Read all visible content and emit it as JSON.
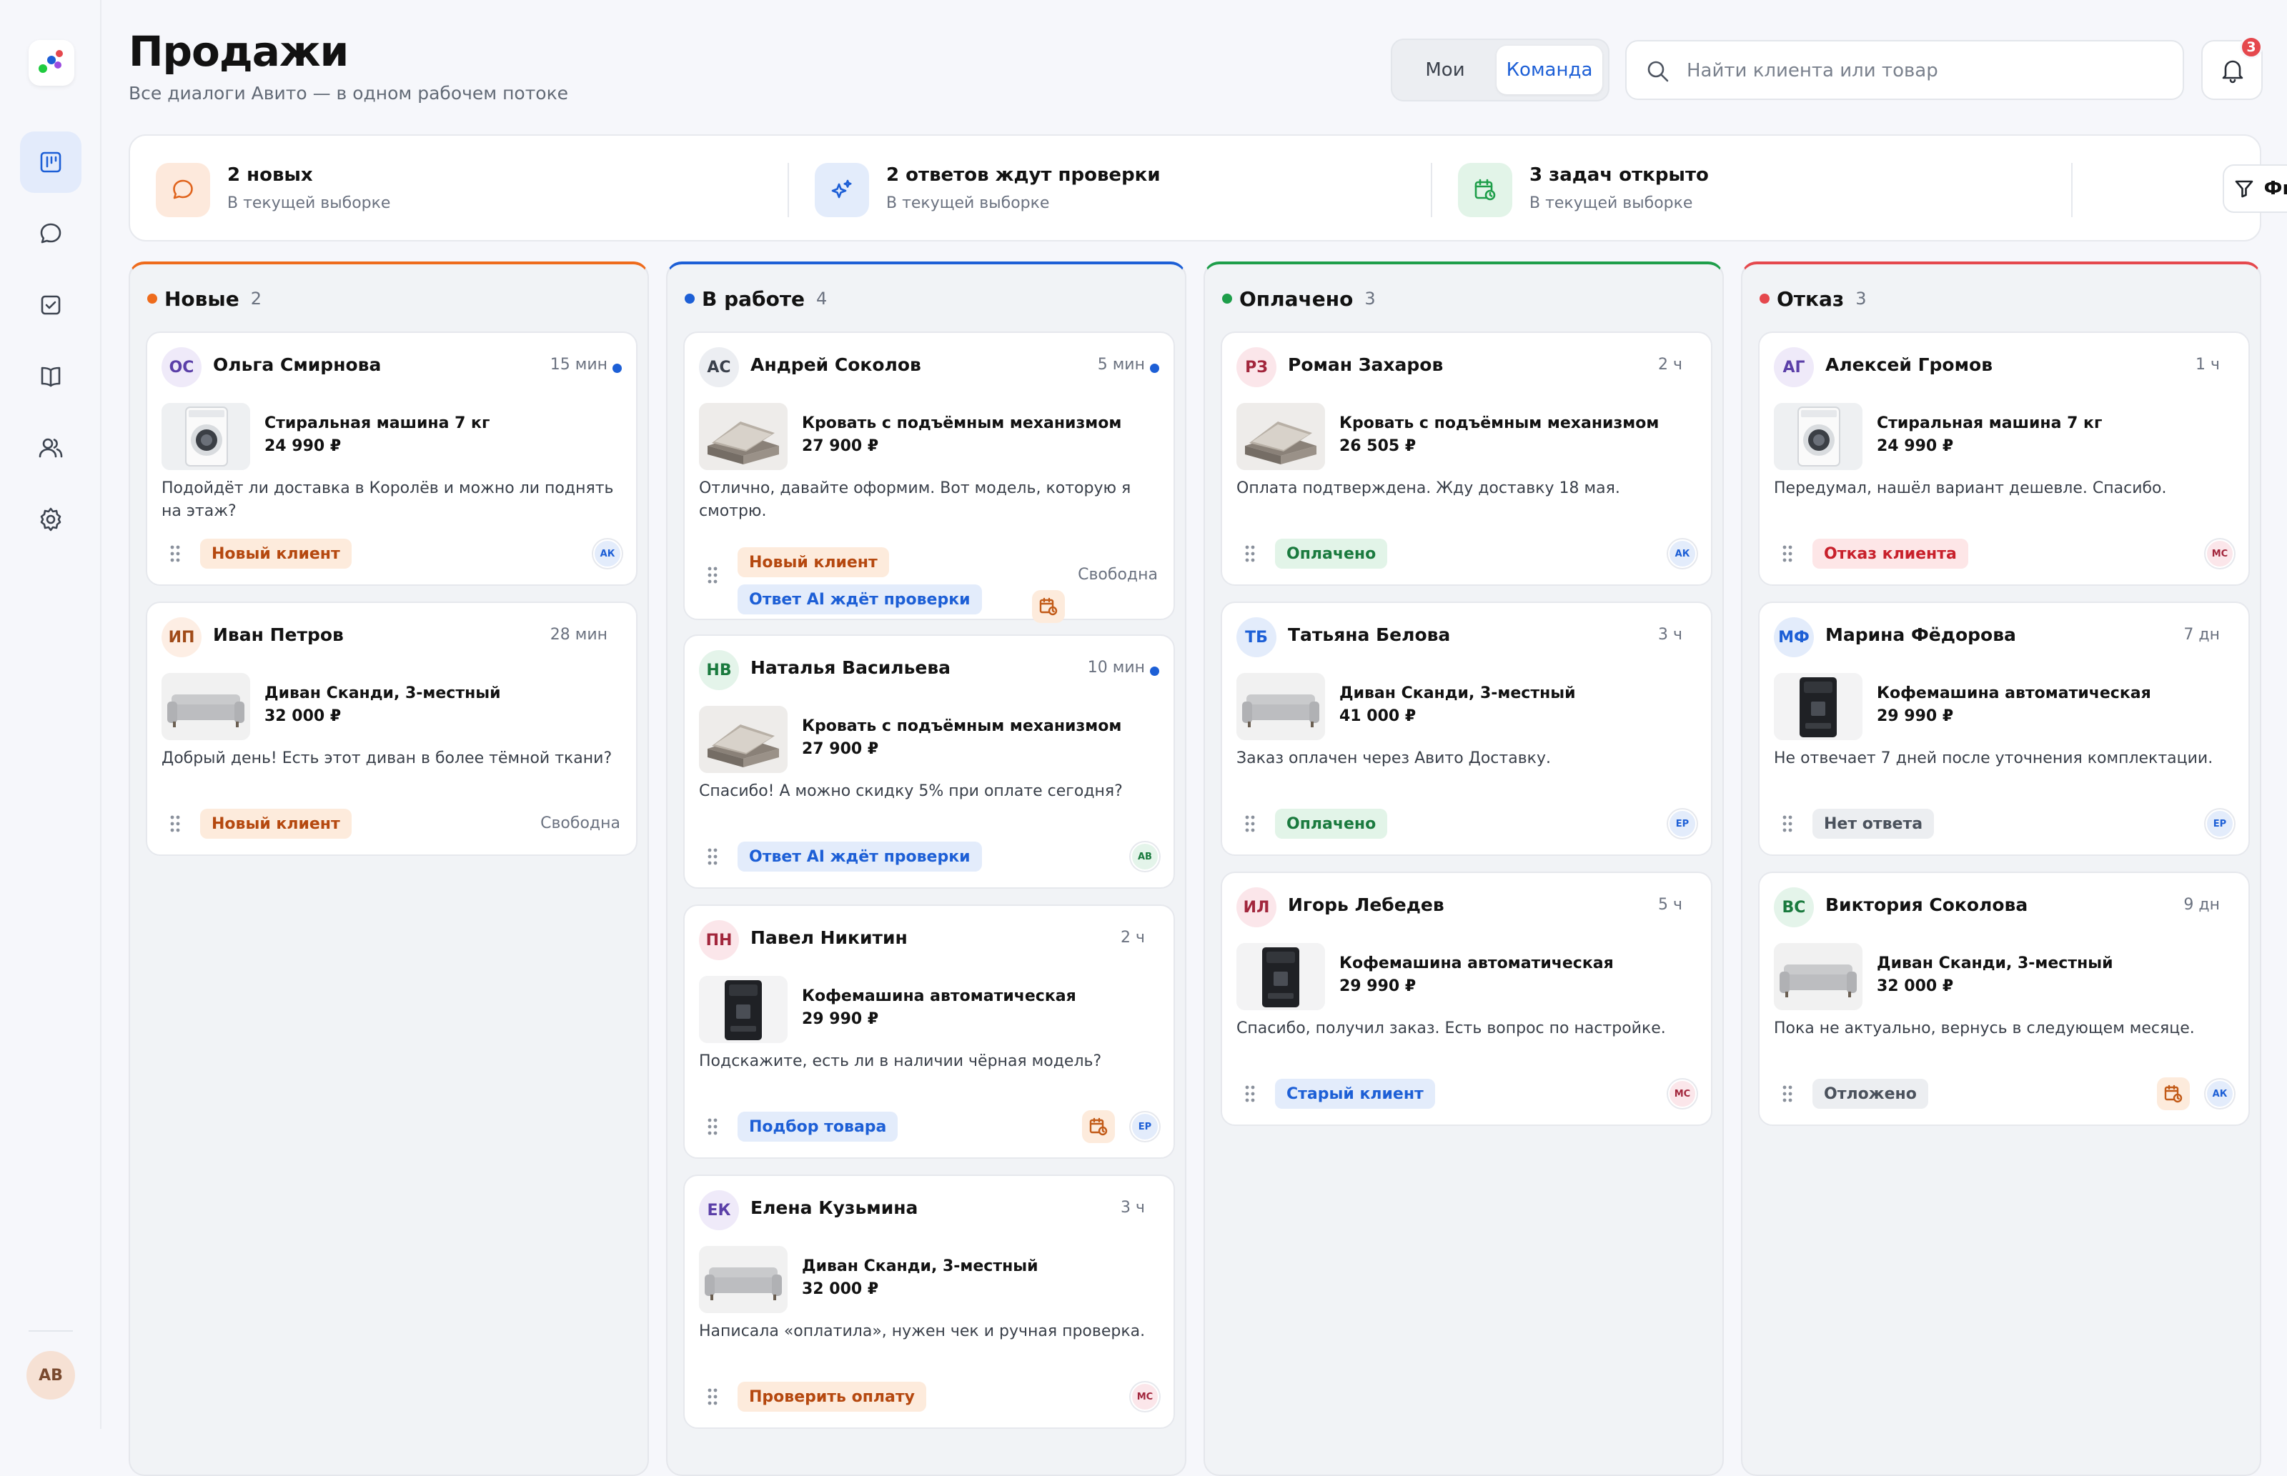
{
  "page": {
    "title": "Продажи",
    "subtitle": "Все диалоги Авито — в одном рабочем потоке"
  },
  "scope": {
    "mine": "Мои",
    "team": "Команда",
    "selected": "Команда"
  },
  "search": {
    "placeholder": "Найти клиента или товар",
    "value": ""
  },
  "notifications": {
    "count": "3"
  },
  "user": {
    "initials": "AB"
  },
  "stats": [
    {
      "title": "2 новых",
      "caption": "В текущей выборке",
      "icon": "chat-icon"
    },
    {
      "title": "2 ответов ждут проверки",
      "caption": "В текущей выборке",
      "icon": "sparkle-icon"
    },
    {
      "title": "3 задач открыто",
      "caption": "В текущей выборке",
      "icon": "calendar-clock-icon"
    }
  ],
  "filters_label": "Фильтры",
  "colors": {
    "new": "#ee6b1c",
    "in_work": "#1d5fd6",
    "paid": "#1e9e4a",
    "rejected": "#e5484d"
  },
  "columns": [
    {
      "name": "Новые",
      "count": "2",
      "cards": [
        {
          "initials": "ОС",
          "name": "Ольга Смирнова",
          "time": "15 мин",
          "product": "Стиральная машина 7 кг",
          "price": "24 990 ₽",
          "message": "Подойдёт ли доставка в Королёв и можно ли поднять на этаж?",
          "tags": [
            "Новый клиент"
          ],
          "assignee": "АК"
        },
        {
          "initials": "ИП",
          "name": "Иван Петров",
          "time": "28 мин",
          "product": "Диван Сканди, 3-местный",
          "price": "32 000 ₽",
          "message": "Добрый день! Есть этот диван в более тёмной ткани?",
          "tags": [
            "Новый клиент"
          ],
          "assignee_text": "Свободна"
        }
      ]
    },
    {
      "name": "В работе",
      "count": "4",
      "cards": [
        {
          "initials": "АС",
          "name": "Андрей Соколов",
          "time": "5 мин",
          "product": "Кровать с подъёмным механизмом",
          "price": "27 900 ₽",
          "message": "Отлично, давайте оформим. Вот модель, которую я смотрю.",
          "tags": [
            "Новый клиент",
            "Ответ AI ждёт проверки"
          ],
          "assignee_text": "Свободна"
        },
        {
          "initials": "НВ",
          "name": "Наталья Васильева",
          "time": "10 мин",
          "product": "Кровать с подъёмным механизмом",
          "price": "27 900 ₽",
          "message": "Спасибо! А можно скидку 5% при оплате сегодня?",
          "tags": [
            "Ответ AI ждёт проверки"
          ],
          "assignee": "АВ"
        },
        {
          "initials": "ПН",
          "name": "Павел Никитин",
          "time": "2 ч",
          "product": "Кофемашина автоматическая",
          "price": "29 990 ₽",
          "message": "Подскажите, есть ли в наличии чёрная модель?",
          "tags": [
            "Подбор товара"
          ],
          "assignee": "ЕР"
        },
        {
          "initials": "ЕК",
          "name": "Елена Кузьмина",
          "time": "3 ч",
          "product": "Диван Сканди, 3-местный",
          "price": "32 000 ₽",
          "message": "Написала «оплатила», нужен чек и ручная проверка.",
          "tags": [
            "Проверить оплату"
          ],
          "assignee": "МС"
        }
      ]
    },
    {
      "name": "Оплачено",
      "count": "3",
      "cards": [
        {
          "initials": "РЗ",
          "name": "Роман Захаров",
          "time": "2 ч",
          "product": "Кровать с подъёмным механизмом",
          "price": "26 505 ₽",
          "message": "Оплата подтверждена. Жду доставку 18 мая.",
          "tags": [
            "Оплачено"
          ],
          "assignee": "АК"
        },
        {
          "initials": "ТБ",
          "name": "Татьяна Белова",
          "time": "3 ч",
          "product": "Диван Сканди, 3-местный",
          "price": "41 000 ₽",
          "message": "Заказ оплачен через Авито Доставку.",
          "tags": [
            "Оплачено"
          ],
          "assignee": "ЕР"
        },
        {
          "initials": "ИЛ",
          "name": "Игорь Лебедев",
          "time": "5 ч",
          "product": "Кофемашина автоматическая",
          "price": "29 990 ₽",
          "message": "Спасибо, получил заказ. Есть вопрос по настройке.",
          "tags": [
            "Старый клиент"
          ],
          "assignee": "МС"
        }
      ]
    },
    {
      "name": "Отказ",
      "count": "3",
      "cards": [
        {
          "initials": "АГ",
          "name": "Алексей Громов",
          "time": "1 ч",
          "product": "Стиральная машина 7 кг",
          "price": "24 990 ₽",
          "message": "Передумал, нашёл вариант дешевле. Спасибо.",
          "tags": [
            "Отказ клиента"
          ],
          "assignee": "МС"
        },
        {
          "initials": "МФ",
          "name": "Марина Фёдорова",
          "time": "7 дн",
          "product": "Кофемашина автоматическая",
          "price": "29 990 ₽",
          "message": "Не отвечает 7 дней после уточнения комплектации.",
          "tags": [
            "Нет ответа"
          ],
          "assignee": "ЕР"
        },
        {
          "initials": "ВС",
          "name": "Виктория Соколова",
          "time": "9 дн",
          "product": "Диван Сканди, 3-местный",
          "price": "32 000 ₽",
          "message": "Пока не актуально, вернусь в следующем месяце.",
          "tags": [
            "Отложено"
          ],
          "assignee": "АК"
        }
      ]
    }
  ]
}
